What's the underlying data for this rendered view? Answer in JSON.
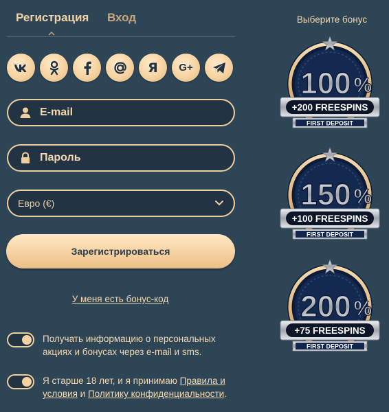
{
  "tabs": {
    "register": "Регистрация",
    "login": "Вход"
  },
  "socials": [
    {
      "name": "vk-icon",
      "glyph": "vk"
    },
    {
      "name": "odnoklassniki-icon",
      "glyph": "ok"
    },
    {
      "name": "facebook-icon",
      "glyph": "f"
    },
    {
      "name": "mail-ru-icon",
      "glyph": "@"
    },
    {
      "name": "yandex-icon",
      "glyph": "Я"
    },
    {
      "name": "google-plus-icon",
      "glyph": "G+"
    },
    {
      "name": "telegram-icon",
      "glyph": "tg"
    }
  ],
  "form": {
    "email_placeholder": "E-mail",
    "password_placeholder": "Пароль",
    "currency_value": "Евро (€)",
    "register_button": "Зарегистрироваться",
    "bonus_code_link": "У меня есть бонус-код"
  },
  "consents": {
    "promo_text": "Получать информацию о персональных акциях и бонусах через e-mail и sms.",
    "age_text_prefix": "Я старше 18 лет, и я принимаю ",
    "age_rules_link": "Правила и условия",
    "age_and": " и ",
    "age_privacy_link": "Политику конфиденциальности",
    "age_suffix": "."
  },
  "bonus": {
    "title": "Выберите бонус",
    "offers": [
      {
        "percent": "100",
        "freespins": "+200 FREESPINS",
        "deposit": "FIRST DEPOSIT"
      },
      {
        "percent": "150",
        "freespins": "+100 FREESPINS",
        "deposit": "FIRST DEPOSIT"
      },
      {
        "percent": "200",
        "freespins": "+75 FREESPINS",
        "deposit": "FIRST DEPOSIT"
      }
    ],
    "percent_sign": "%"
  },
  "colors": {
    "background": "#2e4556",
    "accent": "#f3d7ae",
    "badge_navy": "#0f2346",
    "badge_silver": "#c9ccd2",
    "badge_gold": "#e7c08b"
  }
}
